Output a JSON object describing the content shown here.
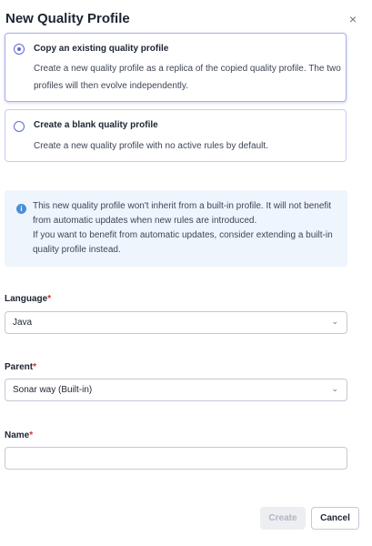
{
  "dialog": {
    "title": "New Quality Profile",
    "close_symbol": "×"
  },
  "options": [
    {
      "title": "Copy an existing quality profile",
      "description": "Create a new quality profile as a replica of the copied quality profile. The two profiles will then evolve independently.",
      "selected": true
    },
    {
      "title": "Create a blank quality profile",
      "description": "Create a new quality profile with no active rules by default.",
      "selected": false
    }
  ],
  "info": {
    "line1": "This new quality profile won't inherit from a built-in profile. It will not benefit from automatic updates when new rules are introduced.",
    "line2": "If you want to benefit from automatic updates, consider extending a built-in quality profile instead."
  },
  "form": {
    "language": {
      "label": "Language",
      "required_mark": "*",
      "value": "Java"
    },
    "parent": {
      "label": "Parent",
      "required_mark": "*",
      "value": "Sonar way (Built-in)"
    },
    "name": {
      "label": "Name",
      "required_mark": "*",
      "value": "",
      "placeholder": ""
    }
  },
  "buttons": {
    "create_label": "Create",
    "cancel_label": "Cancel"
  },
  "icons": {
    "info": "info-icon",
    "chevron": "chevron-down-icon",
    "close": "close-icon"
  },
  "colors": {
    "accent": "#5d6cd0",
    "required": "#d02f3a",
    "info_bg": "#eef5fd",
    "info_icon": "#4a8fd6"
  }
}
